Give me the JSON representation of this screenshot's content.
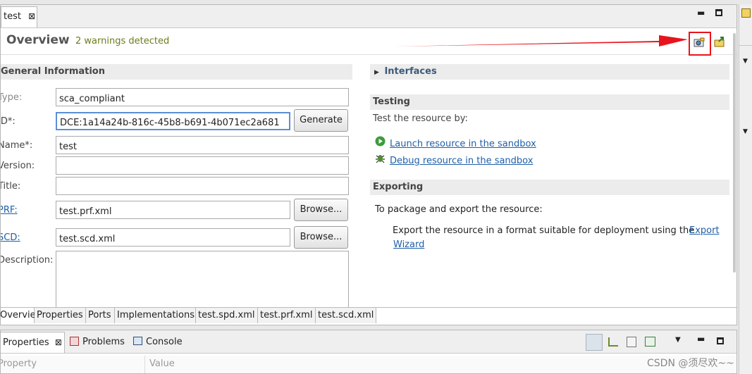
{
  "editor": {
    "tab_label": "test",
    "close_glyph": "⊠",
    "title": "Overview",
    "warnings": "2 warnings detected"
  },
  "general": {
    "header": "General Information",
    "type_label": "Type:",
    "type_value": "sca_compliant",
    "id_label": "ID*:",
    "id_value": "DCE:1a14a24b-816c-45b8-b691-4b071ec2a681",
    "generate_label": "Generate",
    "name_label": "Name*:",
    "name_value": "test",
    "version_label": "Version:",
    "version_value": "",
    "title_label": "Title:",
    "title_value": "",
    "prf_label": "PRF:",
    "prf_value": "test.prf.xml",
    "scd_label": "SCD:",
    "scd_value": "test.scd.xml",
    "browse_label": "Browse...",
    "description_label": "Description:",
    "description_value": ""
  },
  "interfaces": {
    "header": "Interfaces"
  },
  "testing": {
    "header": "Testing",
    "intro": "Test the resource by:",
    "launch": "Launch resource in the sandbox",
    "debug": "Debug resource in the sandbox"
  },
  "exporting": {
    "header": "Exporting",
    "intro": "To package and export the resource:",
    "text": "Export the resource in a format suitable for deployment using the",
    "link_a": "Export",
    "link_b": "Wizard"
  },
  "bottom_tabs": [
    "Overview",
    "Properties",
    "Ports",
    "Implementations",
    "test.spd.xml",
    "test.prf.xml",
    "test.scd.xml"
  ],
  "panel": {
    "tabs": [
      "Properties",
      "Problems",
      "Console"
    ],
    "col_property": "Property",
    "col_value": "Value"
  },
  "watermark": "CSDN @须尽欢~~",
  "colors": {
    "annotation": "#e8141c",
    "link": "#1f5fa8",
    "warning_text": "#6b7d1c"
  },
  "icons": [
    "close-icon",
    "minimize-icon",
    "maximize-icon",
    "launch-sandbox-icon",
    "export-icon",
    "run-icon",
    "debug-icon",
    "chevron-right-icon"
  ]
}
